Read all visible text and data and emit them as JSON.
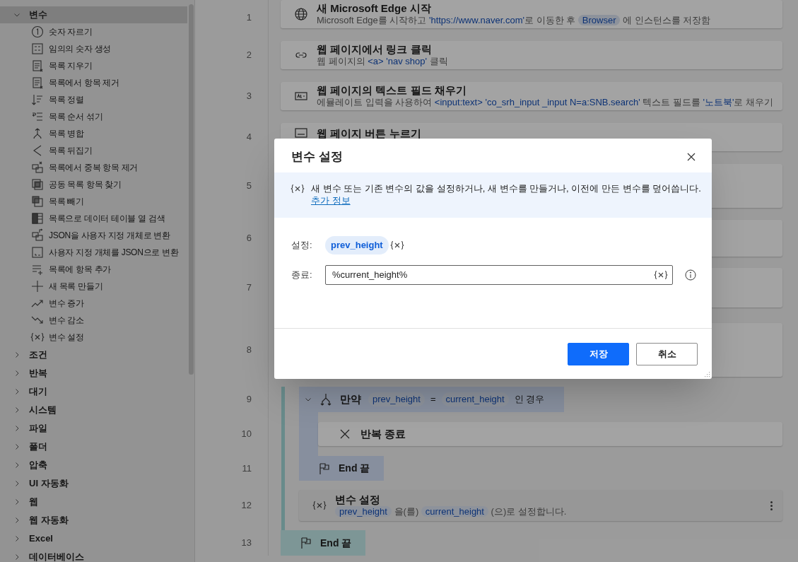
{
  "sidebar": {
    "groups": [
      {
        "label": "변수",
        "expanded": true,
        "selected": true,
        "children": [
          {
            "label": "숫자 자르기"
          },
          {
            "label": "임의의 숫자 생성"
          },
          {
            "label": "목록 지우기"
          },
          {
            "label": "목록에서 항목 제거"
          },
          {
            "label": "목록 정렬"
          },
          {
            "label": "목록 순서 섞기"
          },
          {
            "label": "목록 병합"
          },
          {
            "label": "목록 뒤집기"
          },
          {
            "label": "목록에서 중복 항목 제거"
          },
          {
            "label": "공동 목록 항목 찾기"
          },
          {
            "label": "목록 빼기"
          },
          {
            "label": "목록으로 데이터 테이블 열 검색"
          },
          {
            "label": "JSON을 사용자 지정 개체로 변환"
          },
          {
            "label": "사용자 지정 개체를 JSON으로 변환"
          },
          {
            "label": "목록에 항목 추가"
          },
          {
            "label": "새 목록 만들기"
          },
          {
            "label": "변수 증가"
          },
          {
            "label": "변수 감소"
          },
          {
            "label": "변수 설정"
          }
        ]
      },
      {
        "label": "조건",
        "expanded": false,
        "selected": false
      },
      {
        "label": "반복",
        "expanded": false,
        "selected": false
      },
      {
        "label": "대기",
        "expanded": false,
        "selected": false
      },
      {
        "label": "시스템",
        "expanded": false,
        "selected": false
      },
      {
        "label": "파일",
        "expanded": false,
        "selected": false
      },
      {
        "label": "폴더",
        "expanded": false,
        "selected": false
      },
      {
        "label": "압축",
        "expanded": false,
        "selected": false
      },
      {
        "label": "UI 자동화",
        "expanded": false,
        "selected": false
      },
      {
        "label": "웹",
        "expanded": false,
        "selected": false
      },
      {
        "label": "웹 자동화",
        "expanded": false,
        "selected": false
      },
      {
        "label": "Excel",
        "expanded": false,
        "selected": false
      },
      {
        "label": "데이터베이스",
        "expanded": false,
        "selected": false
      }
    ]
  },
  "steps": [
    {
      "number": "1",
      "kind": "action",
      "selected": false,
      "title": "새 Microsoft Edge 시작",
      "description": [
        {
          "kind": "text",
          "text": "Microsoft Edge를 시작하고 "
        },
        {
          "kind": "literal",
          "text": "'https://www.naver.com'"
        },
        {
          "kind": "text",
          "text": "로 이동한 후 "
        },
        {
          "kind": "variable",
          "text": "Browser"
        },
        {
          "kind": "text",
          "text": " 에 인스턴스를 저장함"
        }
      ]
    },
    {
      "number": "2",
      "kind": "action",
      "selected": false,
      "title": "웹 페이지에서 링크 클릭",
      "description": [
        {
          "kind": "text",
          "text": "웹 페이지의 "
        },
        {
          "kind": "literal",
          "text": "<a> 'nav shop'"
        },
        {
          "kind": "text",
          "text": " 클릭"
        }
      ]
    },
    {
      "number": "3",
      "kind": "action",
      "selected": false,
      "title": "웹 페이지의 텍스트 필드 채우기",
      "description": [
        {
          "kind": "text",
          "text": "에뮬레이트 입력을 사용하여 "
        },
        {
          "kind": "literal",
          "text": "<input:text> 'co_srh_input _input N=a:SNB.search'"
        },
        {
          "kind": "text",
          "text": " 텍스트 필드를 "
        },
        {
          "kind": "literal",
          "text": "'노트북'"
        },
        {
          "kind": "text",
          "text": "로 채우기"
        }
      ]
    },
    {
      "number": "4",
      "kind": "action",
      "selected": false,
      "title": "웹 페이지 버튼 누르기"
    },
    {
      "number": "5",
      "kind": "action",
      "selected": false
    },
    {
      "number": "6",
      "kind": "action",
      "selected": false
    },
    {
      "number": "7",
      "kind": "action",
      "selected": false
    },
    {
      "number": "8",
      "kind": "loop",
      "selected": false,
      "children": [
        {
          "number": "9",
          "kind": "if",
          "expanded": true,
          "selected": false,
          "title": "만약",
          "condition": [
            {
              "kind": "variable",
              "text": "prev_height"
            },
            {
              "kind": "text",
              "text": "="
            },
            {
              "kind": "variable",
              "text": "current_height"
            },
            {
              "kind": "text",
              "text": "인 경우"
            }
          ],
          "children": [
            {
              "number": "10",
              "kind": "action",
              "selected": false,
              "title": "반복 종료"
            }
          ]
        },
        {
          "number": "11",
          "kind": "end",
          "selected": false,
          "title": "End 끝"
        },
        {
          "number": "12",
          "kind": "action",
          "selected": true,
          "title": "변수 설정",
          "description": [
            {
              "kind": "variable",
              "text": "prev_height"
            },
            {
              "kind": "text",
              "text": " 을(를) "
            },
            {
              "kind": "variable",
              "text": "current_height"
            },
            {
              "kind": "text",
              "text": " (으)로 설정합니다."
            }
          ]
        }
      ]
    },
    {
      "number": "13",
      "kind": "end",
      "selected": false,
      "title": "End 끝"
    }
  ],
  "modal": {
    "title": "변수 설정",
    "info_text": "새 변수 또는 기존 변수의 값을 설정하거나, 새 변수를 만들거나, 이전에 만든 변수를 덮어씁니다.",
    "info_link": "추가 정보",
    "fields": [
      {
        "kind": "variable",
        "label": "설정:",
        "value": "prev_height"
      },
      {
        "kind": "input",
        "label": "종료:",
        "value": "%current_height%"
      }
    ],
    "buttons": [
      {
        "kind": "primary",
        "label": "저장"
      },
      {
        "kind": "secondary",
        "label": "취소"
      }
    ]
  }
}
